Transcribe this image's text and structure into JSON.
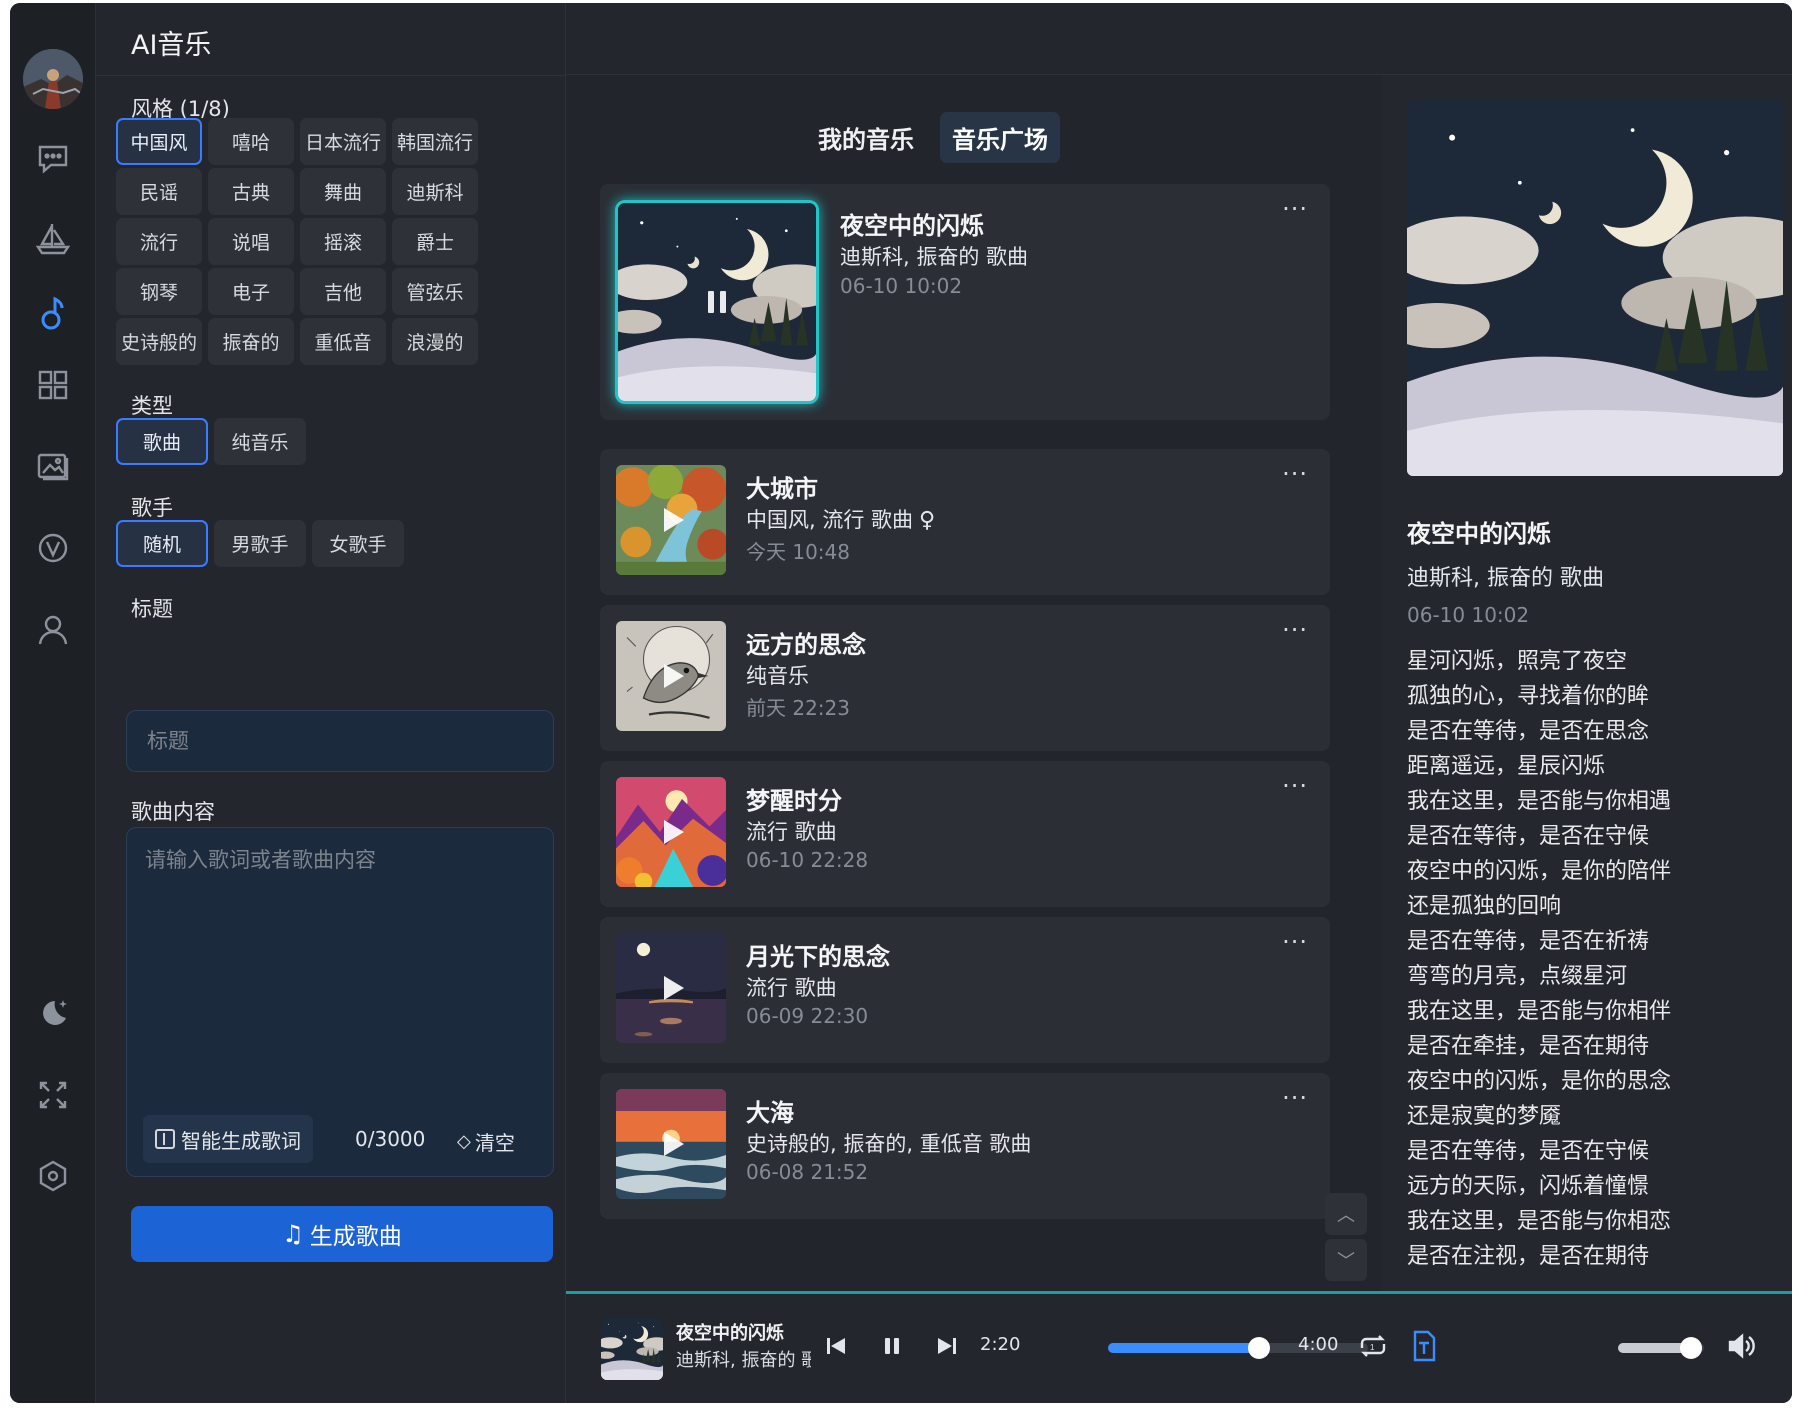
{
  "app": {
    "title": "AI音乐"
  },
  "rail": {
    "icons": [
      "avatar",
      "chat-icon",
      "sailboat-icon",
      "music-note-icon",
      "apps-grid-icon",
      "image-gallery-icon",
      "v-badge-icon",
      "user-icon",
      "dark-mode-icon",
      "fullscreen-icon",
      "settings-icon"
    ],
    "active": "music-note-icon"
  },
  "form": {
    "style_label": "风格 (1/8)",
    "styles": [
      "中国风",
      "嘻哈",
      "日本流行",
      "韩国流行",
      "民谣",
      "古典",
      "舞曲",
      "迪斯科",
      "流行",
      "说唱",
      "摇滚",
      "爵士",
      "钢琴",
      "电子",
      "吉他",
      "管弦乐",
      "史诗般的",
      "振奋的",
      "重低音",
      "浪漫的"
    ],
    "styles_selected": [
      "中国风"
    ],
    "type_label": "类型",
    "types": [
      "歌曲",
      "纯音乐"
    ],
    "type_selected": "歌曲",
    "singer_label": "歌手",
    "singers": [
      "随机",
      "男歌手",
      "女歌手"
    ],
    "singer_selected": "随机",
    "title_label": "标题",
    "title_placeholder": "标题",
    "content_label": "歌曲内容",
    "content_placeholder": "请输入歌词或者歌曲内容",
    "gen_lyrics_label": "智能生成歌词",
    "char_count": "0/3000",
    "clear_label": "清空",
    "generate_label": "生成歌曲"
  },
  "tabs": [
    {
      "label": "我的音乐",
      "active": false
    },
    {
      "label": "音乐广场",
      "active": true
    }
  ],
  "songs": [
    {
      "title": "夜空中的闪烁",
      "meta": "迪斯科, 振奋的 歌曲",
      "date": "06-10 10:02",
      "playing": true,
      "cover": "night-moon"
    },
    {
      "title": "大城市",
      "meta": "中国风, 流行 歌曲",
      "female": "♀",
      "date": "今天 10:48",
      "playing": false,
      "cover": "autumn-river"
    },
    {
      "title": "远方的思念",
      "meta": "纯音乐",
      "date": "前天 22:23",
      "playing": false,
      "cover": "sketch-bird"
    },
    {
      "title": "梦醒时分",
      "meta": "流行 歌曲",
      "date": "06-10 22:28",
      "playing": false,
      "cover": "colorful-mountains"
    },
    {
      "title": "月光下的思念",
      "meta": "流行 歌曲",
      "date": "06-09 22:30",
      "playing": false,
      "cover": "moonlit-lake"
    },
    {
      "title": "大海",
      "meta": "史诗般的, 振奋的, 重低音 歌曲",
      "date": "06-08 21:52",
      "playing": false,
      "cover": "sunset-sea"
    }
  ],
  "more_label": "···",
  "detail": {
    "title": "夜空中的闪烁",
    "meta": "迪斯科, 振奋的 歌曲",
    "date": "06-10 10:02",
    "lyrics": [
      "星河闪烁，照亮了夜空",
      "孤独的心，寻找着你的眸",
      "是否在等待，是否在思念",
      "距离遥远，星辰闪烁",
      "我在这里，是否能与你相遇",
      "是否在等待，是否在守候",
      "夜空中的闪烁，是你的陪伴",
      "还是孤独的回响",
      "是否在等待，是否在祈祷",
      "弯弯的月亮，点缀星河",
      "我在这里，是否能与你相伴",
      "是否在牵挂，是否在期待",
      "夜空中的闪烁，是你的思念",
      "还是寂寞的梦魇",
      "是否在等待，是否在守候",
      "远方的天际，闪烁着憧憬",
      "我在这里，是否能与你相恋",
      "是否在注视，是否在期待"
    ]
  },
  "player": {
    "title": "夜空中的闪烁",
    "meta": "迪斯科, 振奋的 歌曲",
    "current_time": "2:20",
    "total_time": "4:00",
    "progress": 0.58,
    "volume": 0.85,
    "colors": {
      "accent": "#3a8dff",
      "glow": "#22c4c8",
      "primary_button": "#1c63d6"
    }
  }
}
